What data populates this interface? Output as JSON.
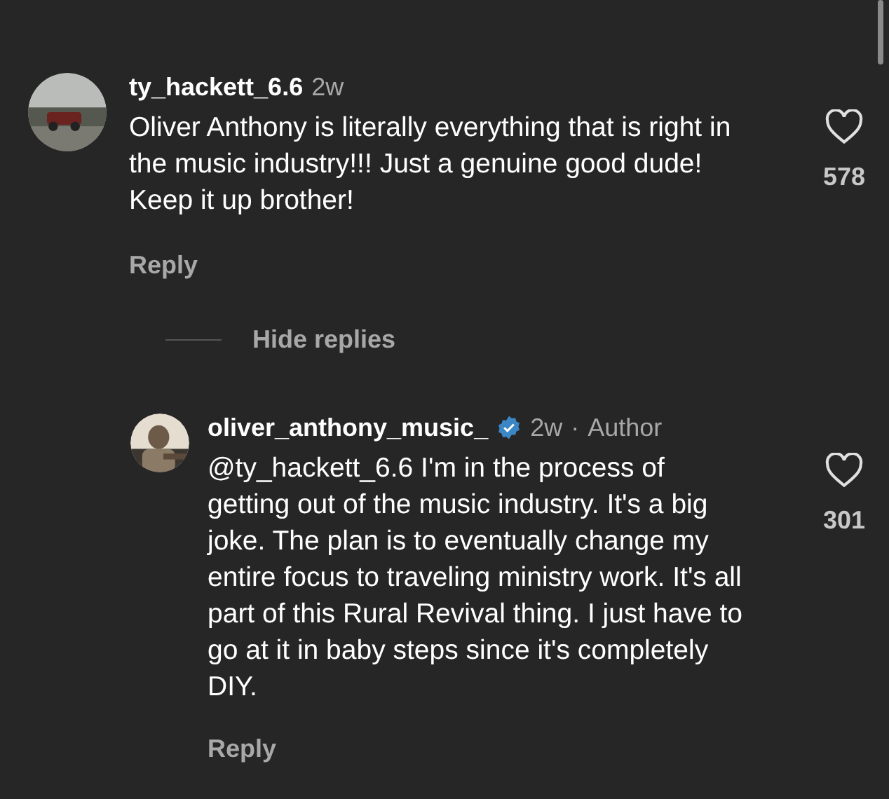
{
  "comments": [
    {
      "username": "ty_hackett_6.6",
      "time": "2w",
      "text": "Oliver Anthony is literally everything that is right in the music industry!!! Just a genuine good dude! Keep it up brother!",
      "likes": "578",
      "reply_label": "Reply",
      "toggle_replies": "Hide replies",
      "children": [
        {
          "username": "oliver_anthony_music_",
          "verified": true,
          "time": "2w",
          "separator": "·",
          "badge": "Author",
          "text": "@ty_hackett_6.6 I'm in the process of getting out of the music industry. It's a big joke. The plan is to eventually change my entire focus to traveling ministry work. It's all part of this Rural Revival thing. I just have to go at it in baby steps since it's completely DIY.",
          "likes": "301",
          "reply_label": "Reply"
        }
      ]
    }
  ]
}
